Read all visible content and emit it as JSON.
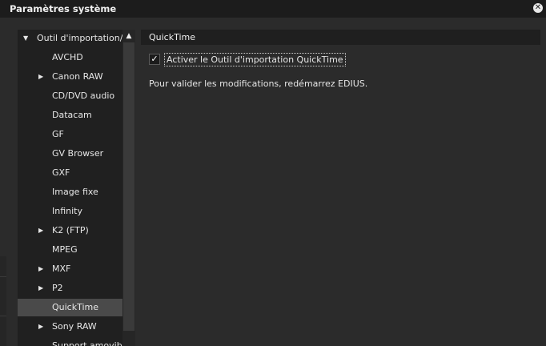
{
  "window": {
    "title": "Paramètres système",
    "close_icon": "close-icon"
  },
  "tree": {
    "items": [
      {
        "label": "Outil d'importation/Out",
        "arrow": "▼",
        "level": 0,
        "selected": false
      },
      {
        "label": "AVCHD",
        "arrow": "",
        "level": 1,
        "selected": false
      },
      {
        "label": "Canon RAW",
        "arrow": "▶",
        "level": 1,
        "selected": false
      },
      {
        "label": "CD/DVD audio",
        "arrow": "",
        "level": 1,
        "selected": false
      },
      {
        "label": "Datacam",
        "arrow": "",
        "level": 1,
        "selected": false
      },
      {
        "label": "GF",
        "arrow": "",
        "level": 1,
        "selected": false
      },
      {
        "label": "GV Browser",
        "arrow": "",
        "level": 1,
        "selected": false
      },
      {
        "label": "GXF",
        "arrow": "",
        "level": 1,
        "selected": false
      },
      {
        "label": "Image fixe",
        "arrow": "",
        "level": 1,
        "selected": false
      },
      {
        "label": "Infinity",
        "arrow": "",
        "level": 1,
        "selected": false
      },
      {
        "label": "K2 (FTP)",
        "arrow": "▶",
        "level": 1,
        "selected": false
      },
      {
        "label": "MPEG",
        "arrow": "",
        "level": 1,
        "selected": false
      },
      {
        "label": "MXF",
        "arrow": "▶",
        "level": 1,
        "selected": false
      },
      {
        "label": "P2",
        "arrow": "▶",
        "level": 1,
        "selected": false
      },
      {
        "label": "QuickTime",
        "arrow": "",
        "level": 1,
        "selected": true
      },
      {
        "label": "Sony RAW",
        "arrow": "▶",
        "level": 1,
        "selected": false
      },
      {
        "label": "Support amovible",
        "arrow": "",
        "level": 1,
        "selected": false
      }
    ],
    "scroll_up_icon": "▲"
  },
  "content": {
    "header": "QuickTime",
    "checkbox_label": "Activer le Outil d'importation QuickTime",
    "checkbox_checked": true,
    "checkmark": "✓",
    "note": "Pour valider les modifications, redémarrez EDIUS."
  },
  "colors": {
    "background": "#2b2b2b",
    "titlebar": "#1c1c1c",
    "tree_bg": "#202020",
    "selected_row": "#4a4a4a"
  }
}
